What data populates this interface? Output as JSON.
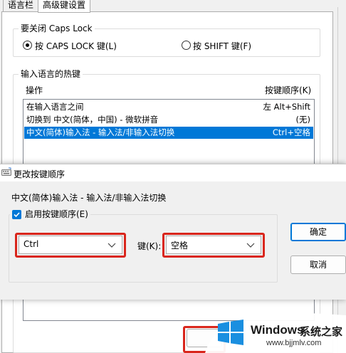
{
  "tabs": [
    {
      "label": "语言栏"
    },
    {
      "label": "高级键设置"
    }
  ],
  "caps_group": {
    "title": "要关闭 Caps Lock",
    "options": [
      {
        "label": "按 CAPS LOCK 键(L)",
        "selected": true
      },
      {
        "label": "按 SHIFT 键(F)",
        "selected": false
      }
    ]
  },
  "hotkey_group": {
    "title": "输入语言的热键",
    "col_action": "操作",
    "col_sequence": "按键顺序(K)",
    "rows": [
      {
        "action": "在输入语言之间",
        "keys": "左 Alt+Shift"
      },
      {
        "action": "切换到 中文(简体，中国) - 微软拼音",
        "keys": "(无)"
      },
      {
        "action": "中文(简体)输入法 - 输入法/非输入法切换",
        "keys": "Ctrl+空格",
        "selected": true
      }
    ]
  },
  "dialog": {
    "title": "更改按键顺序",
    "subject": "中文(简体)输入法 - 输入法/非输入法切换",
    "enable_label": "启用按键顺序(E)",
    "enable_checked": true,
    "modifier_value": "Ctrl",
    "key_label": "键(K):",
    "key_value": "空格",
    "ok_label": "确定",
    "cancel_label": "取消"
  },
  "watermark": {
    "brand": "Windows",
    "site_name": "系统之家",
    "url": "www.bjjmlv.com"
  },
  "colors": {
    "selection": "#0078d7",
    "highlight_box": "#d9261c",
    "windows_logo": "#1a8fe0"
  }
}
